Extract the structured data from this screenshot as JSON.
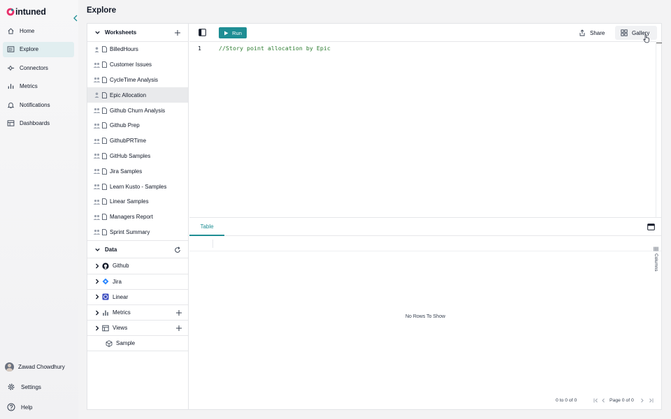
{
  "app": {
    "logo_text": "intuned"
  },
  "nav": {
    "items": [
      {
        "label": "Home",
        "icon": "home-icon"
      },
      {
        "label": "Explore",
        "icon": "explore-icon"
      },
      {
        "label": "Connectors",
        "icon": "connectors-icon"
      },
      {
        "label": "Metrics",
        "icon": "metrics-icon"
      },
      {
        "label": "Notifications",
        "icon": "bell-icon"
      },
      {
        "label": "Dashboards",
        "icon": "dashboard-icon"
      }
    ],
    "active": "Explore",
    "user_name": "Zawad Chowdhury",
    "settings_label": "Settings",
    "help_label": "Help"
  },
  "header": {
    "title": "Explore"
  },
  "worksheets": {
    "title": "Worksheets",
    "items": [
      {
        "label": "BilledHours",
        "shared": false
      },
      {
        "label": "Customer Issues",
        "shared": true
      },
      {
        "label": "CycleTime Analysis",
        "shared": true
      },
      {
        "label": "Epic Allocation",
        "shared": false
      },
      {
        "label": "Github Churn Analysis",
        "shared": true
      },
      {
        "label": "Github Prep",
        "shared": true
      },
      {
        "label": "GithubPRTime",
        "shared": true
      },
      {
        "label": "GitHub Samples",
        "shared": true
      },
      {
        "label": "Jira Samples",
        "shared": true
      },
      {
        "label": "Learn Kusto - Samples",
        "shared": true
      },
      {
        "label": "Linear Samples",
        "shared": true
      },
      {
        "label": "Managers Report",
        "shared": true
      },
      {
        "label": "Sprint Summary",
        "shared": true
      }
    ],
    "selected": "Epic Allocation"
  },
  "data_panel": {
    "title": "Data",
    "items": [
      {
        "label": "Github",
        "icon": "github-icon"
      },
      {
        "label": "Jira",
        "icon": "jira-icon"
      },
      {
        "label": "Linear",
        "icon": "linear-icon"
      },
      {
        "label": "Metrics",
        "icon": "bar-chart-icon"
      },
      {
        "label": "Views",
        "icon": "table-view-icon"
      },
      {
        "label": "Sample",
        "icon": "cube-icon"
      }
    ]
  },
  "toolbar": {
    "run_label": "Run",
    "share_label": "Share",
    "gallery_label": "Gallery"
  },
  "editor": {
    "line_number": "1",
    "code": "//Story point allocation by Epic"
  },
  "results": {
    "tab_label": "Table",
    "empty_message": "No Rows To Show",
    "columns_label": "Columns",
    "row_summary": "0 to 0 of 0",
    "page_label": "Page 0 of 0"
  },
  "colors": {
    "accent": "#1f8e94",
    "selected_nav": "#e1eef0",
    "code_comment": "#2e7d32"
  }
}
